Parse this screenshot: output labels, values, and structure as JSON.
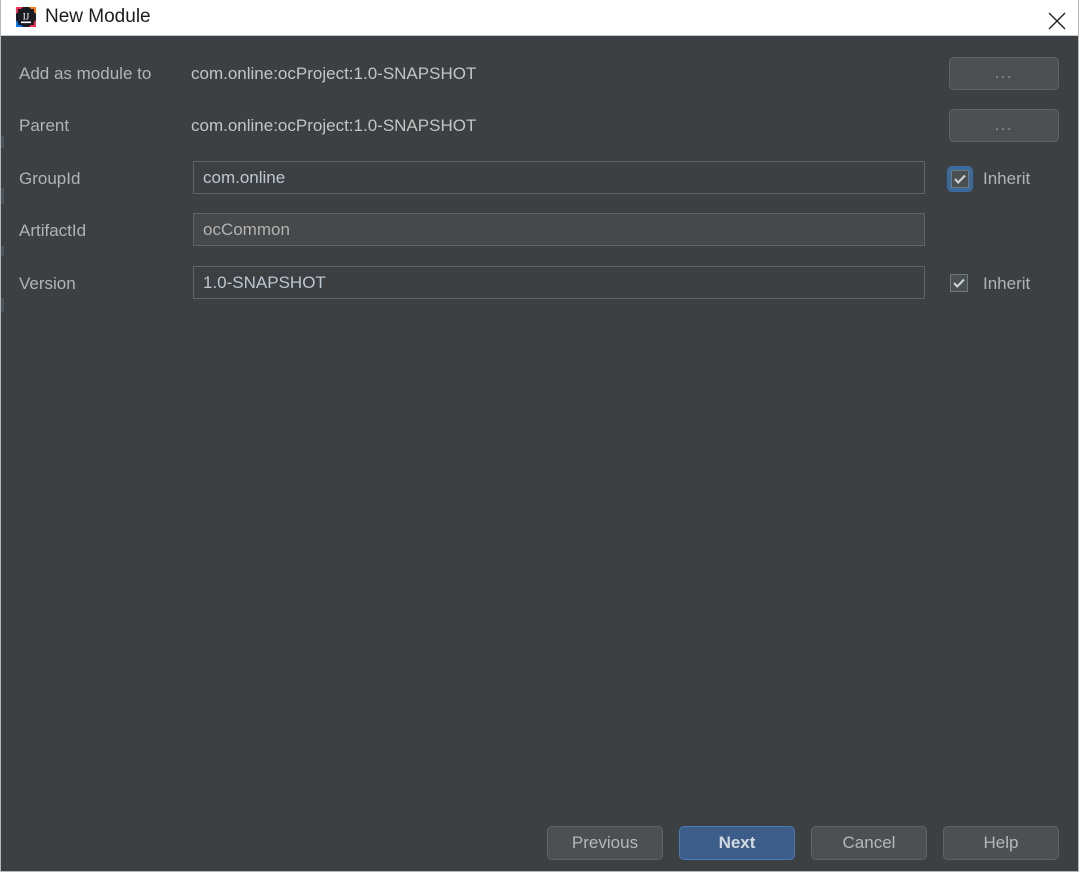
{
  "titlebar": {
    "title": "New Module",
    "app_icon": "intellij-idea-icon",
    "close_icon": "close-icon"
  },
  "form": {
    "rows": [
      {
        "label": "Add as module to",
        "value": "com.online:ocProject:1.0-SNAPSHOT",
        "type": "static",
        "browse_label": "..."
      },
      {
        "label": "Parent",
        "value": "com.online:ocProject:1.0-SNAPSHOT",
        "type": "static",
        "browse_label": "..."
      },
      {
        "label": "GroupId",
        "value": "com.online",
        "type": "input",
        "inherit_label": "Inherit",
        "inherit_checked": true,
        "inherit_focused": true
      },
      {
        "label": "ArtifactId",
        "value": "ocCommon",
        "type": "input"
      },
      {
        "label": "Version",
        "value": "1.0-SNAPSHOT",
        "type": "input",
        "inherit_label": "Inherit",
        "inherit_checked": true,
        "inherit_focused": false
      }
    ]
  },
  "footer": {
    "previous_label": "Previous",
    "next_label": "Next",
    "cancel_label": "Cancel",
    "help_label": "Help"
  },
  "colors": {
    "dialog_background": "#3c4043",
    "titlebar_background": "#ffffff",
    "accent_blue": "#3c5d8a",
    "focus_ring": "#3b6a9e",
    "label_text": "#b2b4b3",
    "input_text": "#bdc7d1"
  }
}
